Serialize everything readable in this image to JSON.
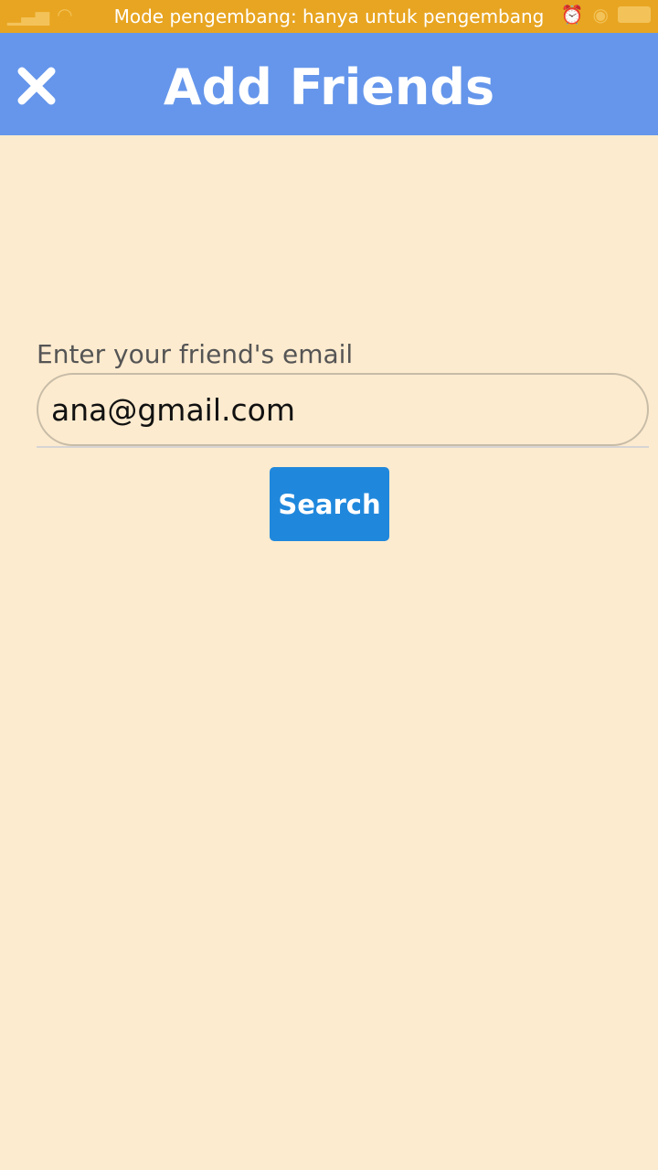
{
  "status_bar": {
    "notification_text": "Mode pengembang: hanya untuk pengembang",
    "left_icons": [
      "signal-icon",
      "sim-3-icon",
      "wifi-icon",
      "notification-icon"
    ],
    "right_icons": [
      "alarm-icon",
      "eye-icon",
      "battery-icon"
    ],
    "color": "#e8a521"
  },
  "app_bar": {
    "title": "Add Friends",
    "close_icon": "close-icon",
    "color": "#6596eb"
  },
  "form": {
    "email_label": "Enter your friend's email",
    "email_value": "ana@gmail.com",
    "search_label": "Search",
    "button_color": "#2088dc"
  },
  "background_color": "#fdebcf"
}
